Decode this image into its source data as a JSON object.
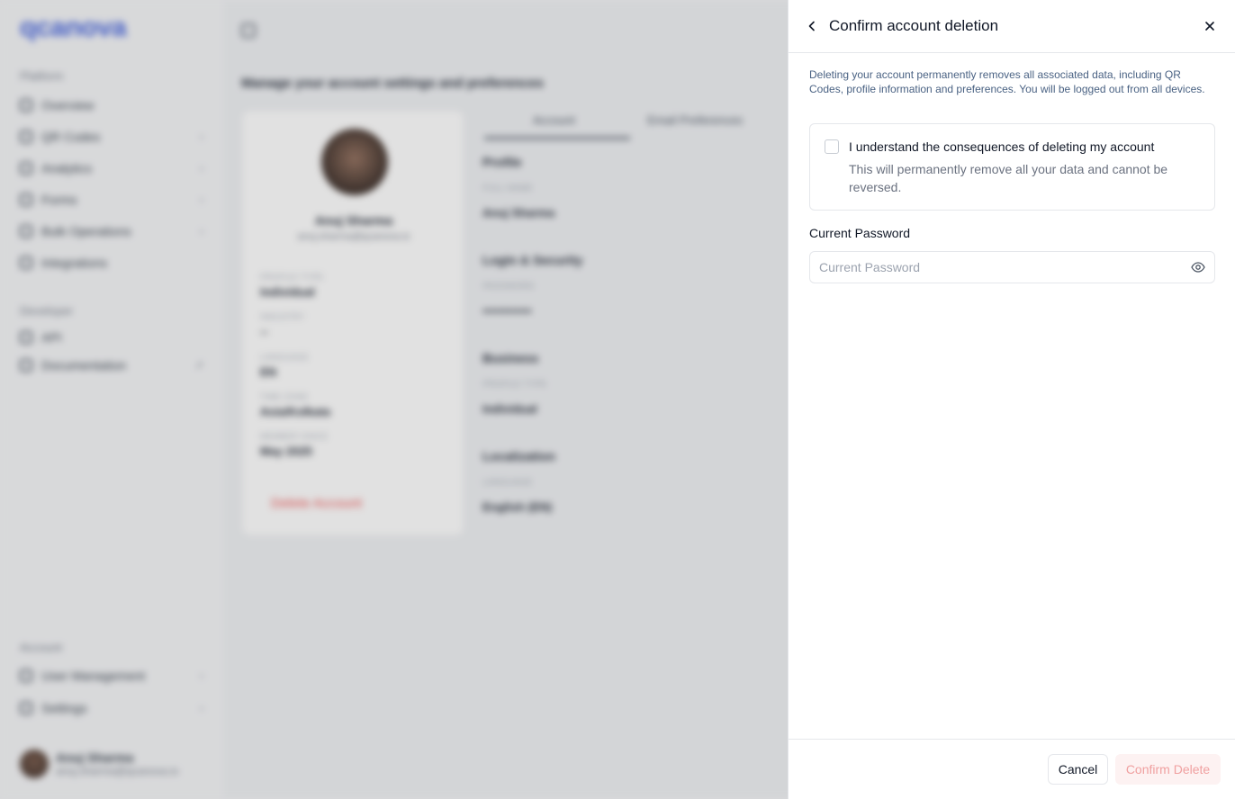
{
  "app": {
    "logo_text": "qcanova",
    "sidebar": {
      "platform_label": "Platform",
      "items": [
        {
          "label": "Overview"
        },
        {
          "label": "QR Codes"
        },
        {
          "label": "Analytics"
        },
        {
          "label": "Forms"
        },
        {
          "label": "Bulk Operations"
        },
        {
          "label": "Integrations"
        }
      ],
      "developer_label": "Developer",
      "dev_items": [
        {
          "label": "API"
        },
        {
          "label": "Documentation"
        }
      ],
      "account_label": "Account",
      "account_items": [
        {
          "label": "User Management"
        },
        {
          "label": "Settings"
        }
      ],
      "user": {
        "name": "Anuj Sharma",
        "email": "anuj.sharma@qcanova.io"
      }
    },
    "main": {
      "title": "Manage your account settings and preferences",
      "profile": {
        "name": "Anuj Sharma",
        "email": "anuj.sharma@qcanova.io",
        "fields": [
          {
            "label": "PROFILE TYPE",
            "value": "Individual"
          },
          {
            "label": "INDUSTRY",
            "value": "--"
          },
          {
            "label": "LANGUAGE",
            "value": "EN"
          },
          {
            "label": "TIME ZONE",
            "value": "Asia/Kolkata"
          },
          {
            "label": "MEMBER SINCE",
            "value": "May 2025"
          }
        ],
        "delete_label": "Delete Account"
      },
      "tabs": [
        "Account",
        "Email Preferences"
      ],
      "sections": [
        {
          "heading": "Profile",
          "label": "FULL NAME",
          "value": "Anuj Sharma"
        },
        {
          "heading": "Login & Security",
          "label": "PASSWORD",
          "value": "••••••••••••"
        },
        {
          "heading": "Business",
          "label": "PROFILE TYPE",
          "value": "Individual"
        },
        {
          "heading": "Localization",
          "label": "LANGUAGE",
          "value": "English (EN)"
        }
      ]
    }
  },
  "drawer": {
    "title": "Confirm account deletion",
    "description": "Deleting your account permanently removes all associated data, including QR Codes, profile information and preferences. You will be logged out from all devices.",
    "consent": {
      "title": "I understand the consequences of deleting my account",
      "subtitle": "This will permanently remove all your data and cannot be reversed.",
      "checked": false
    },
    "password": {
      "label": "Current Password",
      "placeholder": "Current Password",
      "value": ""
    },
    "footer": {
      "cancel_label": "Cancel",
      "confirm_label": "Confirm Delete"
    }
  },
  "colors": {
    "accent": "#3b5bdb",
    "danger": "#ef4444",
    "danger_disabled_bg": "#fdf2f2",
    "danger_disabled_text": "#f0a0a0"
  },
  "icons": {
    "back": "chevron-left-icon",
    "close": "close-icon",
    "eye": "eye-icon"
  }
}
